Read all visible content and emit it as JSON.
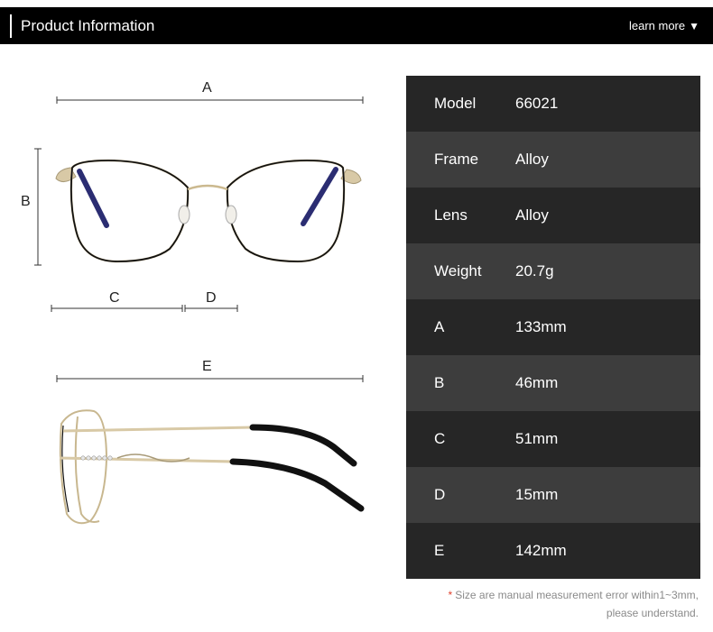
{
  "header": {
    "title": "Product Information",
    "learn_more": "learn more"
  },
  "dimension_labels": {
    "a": "A",
    "b": "B",
    "c": "C",
    "d": "D",
    "e": "E"
  },
  "specs": [
    {
      "key": "Model",
      "value": "66021"
    },
    {
      "key": "Frame",
      "value": "Alloy"
    },
    {
      "key": "Lens",
      "value": "Alloy"
    },
    {
      "key": "Weight",
      "value": "20.7g"
    },
    {
      "key": "A",
      "value": "133mm"
    },
    {
      "key": "B",
      "value": "46mm"
    },
    {
      "key": "C",
      "value": "51mm"
    },
    {
      "key": "D",
      "value": "15mm"
    },
    {
      "key": "E",
      "value": "142mm"
    }
  ],
  "note": {
    "star": "*",
    "line1": "Size are manual measurement error within1~3mm,",
    "line2": "please understand."
  },
  "colors": {
    "header_bg": "#000000",
    "row_dark": "#262626",
    "row_light": "#3d3d3d",
    "note_star": "#e0402d",
    "frame_black": "#111111",
    "frame_gold": "#d8c9a6"
  }
}
